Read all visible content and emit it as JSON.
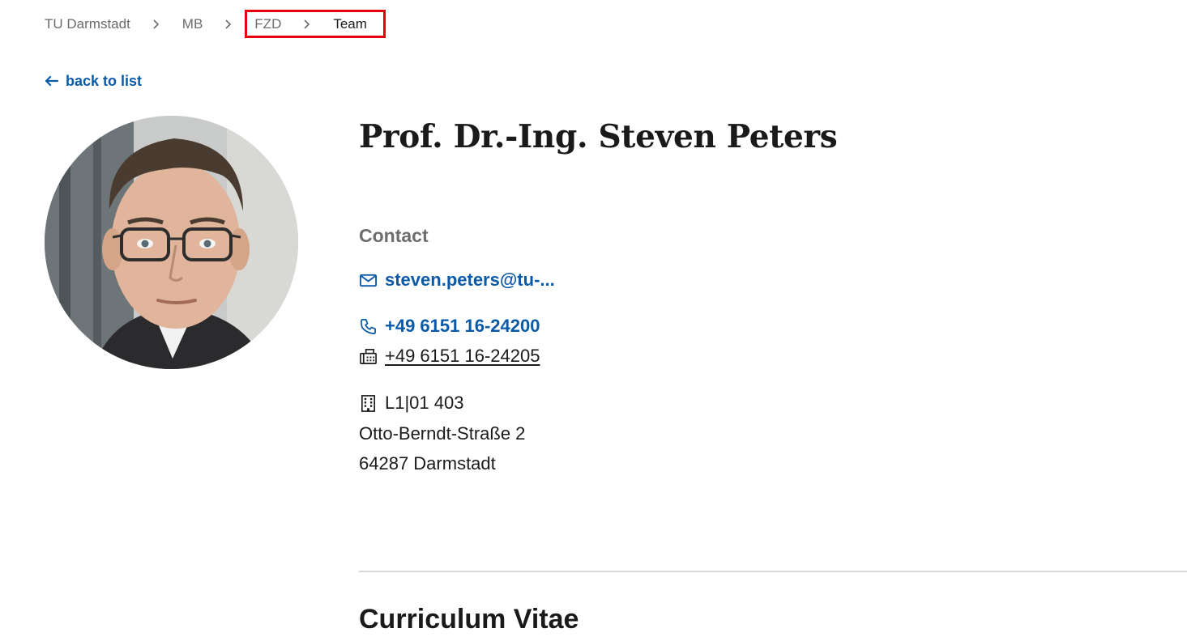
{
  "breadcrumb": {
    "items": [
      {
        "label": "TU Darmstadt"
      },
      {
        "label": "MB"
      },
      {
        "label": "FZD"
      },
      {
        "label": "Team"
      }
    ]
  },
  "back_link": {
    "label": "back to list",
    "icon": "arrow-left-icon"
  },
  "profile": {
    "name": "Prof. Dr.-Ing. Steven Peters",
    "portrait": "profile-photo",
    "contact_heading": "Contact",
    "email": "steven.peters@tu-...",
    "phone": "+49 6151 16-24200",
    "fax": "+49 6151 16-24205",
    "room": "L1|01 403",
    "street": "Otto-Berndt-Straße 2",
    "city": "64287 Darmstadt"
  },
  "sections": {
    "cv_heading": "Curriculum Vitae"
  },
  "colors": {
    "link": "#0a5aa8",
    "highlight": "#e8000b",
    "muted": "#6b6b6b",
    "text": "#1a1a1a"
  }
}
